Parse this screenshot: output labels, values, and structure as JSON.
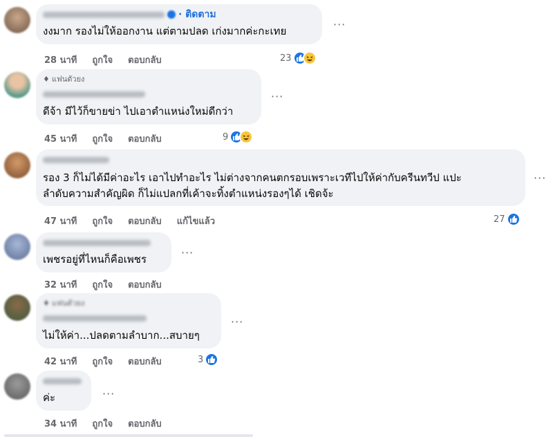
{
  "comments": [
    {
      "badge": "",
      "follow": "· ติดตาม",
      "lines": [
        "งงมาก รองไม่ให้ออกงาน แต่ตามปลด เก่งมากค่ะกะเทย"
      ],
      "time": "28 นาที",
      "like": "ถูกใจ",
      "reply": "ตอบกลับ",
      "edited": "",
      "reaction_count": "23",
      "reactions": [
        "like-icon",
        "haha-icon"
      ]
    },
    {
      "badge": "แฟนตัวยง",
      "follow": "",
      "lines": [
        "ดีจ้า มีไว้ก็ขายข่า ไปเอาตำแหน่งใหม่ดีกว่า"
      ],
      "time": "45 นาที",
      "like": "ถูกใจ",
      "reply": "ตอบกลับ",
      "edited": "",
      "reaction_count": "9",
      "reactions": [
        "like-icon",
        "haha-icon"
      ]
    },
    {
      "badge": "",
      "follow": "",
      "lines": [
        "รอง 3 ก็ไม่ได้มีค่าอะไร เอาไปทำอะไร ไม่ต่างจากคนตกรอบเพราะเวทีไปให้ค่ากับครีนทวีป แปะ",
        "ลำดับความสำคัญผิด ก็ไม่แปลกที่เค้าจะทิ้งตำแหน่งรองๆได้ เชิดจ้ะ"
      ],
      "time": "47 นาที",
      "like": "ถูกใจ",
      "reply": "ตอบกลับ",
      "edited": "แก้ไขแล้ว",
      "reaction_count": "27",
      "reactions": [
        "like-icon"
      ]
    },
    {
      "badge": "",
      "follow": "",
      "lines": [
        "เพชรอยู่ที่ไหนก็คือเพชร"
      ],
      "time": "32 นาที",
      "like": "ถูกใจ",
      "reply": "ตอบกลับ",
      "edited": "",
      "reaction_count": "",
      "reactions": []
    },
    {
      "badge": "แฟนตัวยง",
      "follow": "",
      "lines": [
        "ไม่ให้ค่า...ปลดตามลำบาก...สบายๆ"
      ],
      "time": "42 นาที",
      "like": "ถูกใจ",
      "reply": "ตอบกลับ",
      "edited": "",
      "reaction_count": "3",
      "reactions": [
        "like-icon"
      ]
    },
    {
      "badge": "",
      "follow": "",
      "lines": [
        "ค่ะ"
      ],
      "time": "34 นาที",
      "like": "ถูกใจ",
      "reply": "ตอบกลับ",
      "edited": "",
      "reaction_count": "",
      "reactions": []
    }
  ],
  "more_label": "···",
  "colors": {
    "like": "#1b74e4",
    "haha": "#f7c53a",
    "bubble": "#f0f2f5",
    "meta": "#65676b",
    "follow": "#216fdb"
  }
}
